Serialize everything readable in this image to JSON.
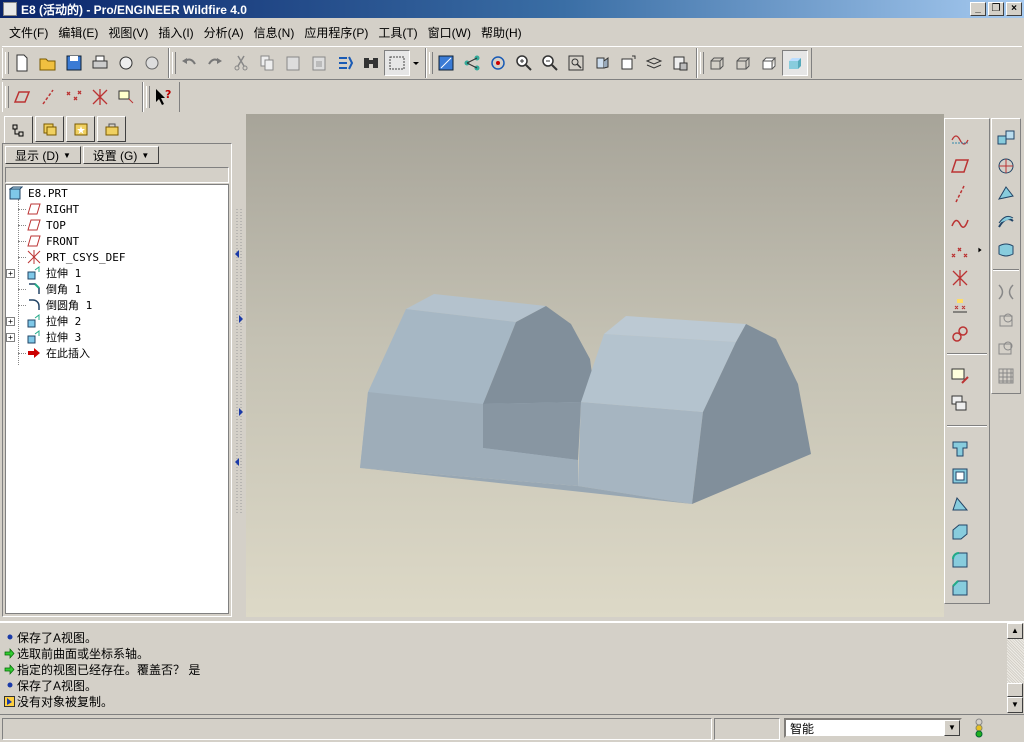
{
  "window": {
    "title": "E8 (活动的) - Pro/ENGINEER Wildfire 4.0",
    "buttons": [
      "_",
      "❐",
      "×"
    ]
  },
  "menu": [
    "文件(F)",
    "编辑(E)",
    "视图(V)",
    "插入(I)",
    "分析(A)",
    "信息(N)",
    "应用程序(P)",
    "工具(T)",
    "窗口(W)",
    "帮助(H)"
  ],
  "tree_controls": {
    "show": "显示 (D)",
    "settings": "设置 (G)"
  },
  "model_tree": [
    "E8.PRT",
    "RIGHT",
    "TOP",
    "FRONT",
    "PRT_CSYS_DEF",
    "拉伸 1",
    "倒角 1",
    "倒圆角 1",
    "拉伸 2",
    "拉伸 3",
    "在此插入"
  ],
  "messages": [
    {
      "icon": "bullet-icon",
      "text": "保存了A视图。"
    },
    {
      "icon": "prompt-arrow-icon",
      "text": "选取前曲面或坐标系轴。"
    },
    {
      "icon": "prompt-arrow-icon",
      "text": "指定的视图已经存在。覆盖否？ 是"
    },
    {
      "icon": "bullet-icon",
      "text": "保存了A视图。"
    },
    {
      "icon": "warning-icon",
      "text": "没有对象被复制。"
    }
  ],
  "status": {
    "filter_value": "智能"
  },
  "colors": {
    "title_start": "#0a246a",
    "title_end": "#a6caf0",
    "viewport_top": "#a7a499",
    "viewport_bottom": "#ddd9c7",
    "model": "#a9b8c3"
  }
}
